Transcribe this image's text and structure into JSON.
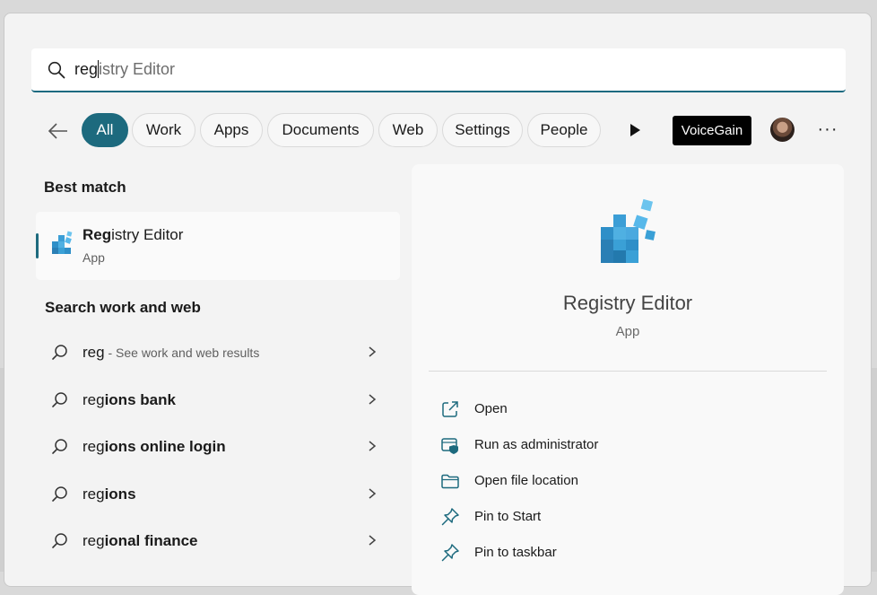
{
  "search": {
    "typed": "reg",
    "ghost": "istry Editor"
  },
  "filters": {
    "chips": [
      "All",
      "Work",
      "Apps",
      "Documents",
      "Web",
      "Settings",
      "People"
    ],
    "voicegain_label": "VoiceGain",
    "more_label": "···"
  },
  "best_match": {
    "title": "Best match",
    "name_bold": "Reg",
    "name_rest": "istry Editor",
    "type": "App"
  },
  "web": {
    "title": "Search work and web",
    "items": [
      {
        "query": "reg",
        "rest": "",
        "sub": " - See work and web results"
      },
      {
        "query": "reg",
        "rest": "ions bank",
        "sub": ""
      },
      {
        "query": "reg",
        "rest": "ions online login",
        "sub": ""
      },
      {
        "query": "reg",
        "rest": "ions",
        "sub": ""
      },
      {
        "query": "reg",
        "rest": "ional finance",
        "sub": ""
      }
    ]
  },
  "preview": {
    "name": "Registry Editor",
    "type": "App",
    "actions": [
      {
        "label": "Open",
        "icon": "open-external-icon"
      },
      {
        "label": "Run as administrator",
        "icon": "shield-admin-icon"
      },
      {
        "label": "Open file location",
        "icon": "folder-icon"
      },
      {
        "label": "Pin to Start",
        "icon": "pin-icon"
      },
      {
        "label": "Pin to taskbar",
        "icon": "pin-icon"
      }
    ]
  },
  "colors": {
    "accent": "#1d6a7e",
    "panel": "#f3f3f3",
    "voicegain_bg": "#000000"
  }
}
